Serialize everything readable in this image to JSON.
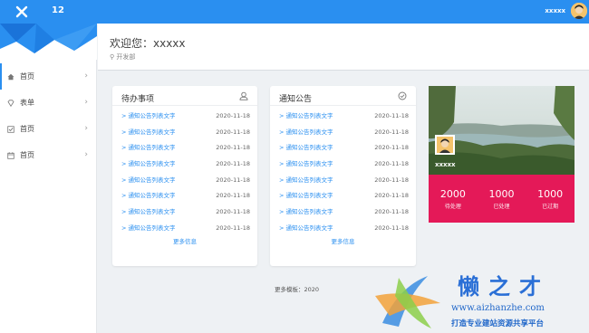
{
  "header": {
    "app_name": "12",
    "user_name": "xxxxx"
  },
  "welcome": {
    "greeting": "欢迎您：xxxxx",
    "department": "开发部"
  },
  "sidebar": {
    "items": [
      {
        "label": "首页",
        "icon": "home-icon"
      },
      {
        "label": "表单",
        "icon": "diamond-icon"
      },
      {
        "label": "首页",
        "icon": "checkbox-icon"
      },
      {
        "label": "首页",
        "icon": "calendar-icon"
      }
    ]
  },
  "todo": {
    "title": "待办事项",
    "more": "更多信息",
    "items": [
      {
        "text": "> 通知公告列表文字",
        "date": "2020-11-18"
      },
      {
        "text": "> 通知公告列表文字",
        "date": "2020-11-18"
      },
      {
        "text": "> 通知公告列表文字",
        "date": "2020-11-18"
      },
      {
        "text": "> 通知公告列表文字",
        "date": "2020-11-18"
      },
      {
        "text": "> 通知公告列表文字",
        "date": "2020-11-18"
      },
      {
        "text": "> 通知公告列表文字",
        "date": "2020-11-18"
      },
      {
        "text": "> 通知公告列表文字",
        "date": "2020-11-18"
      },
      {
        "text": "> 通知公告列表文字",
        "date": "2020-11-18"
      }
    ]
  },
  "notice": {
    "title": "通知公告",
    "more": "更多信息",
    "items": [
      {
        "text": "> 通知公告列表文字",
        "date": "2020-11-18"
      },
      {
        "text": "> 通知公告列表文字",
        "date": "2020-11-18"
      },
      {
        "text": "> 通知公告列表文字",
        "date": "2020-11-18"
      },
      {
        "text": "> 通知公告列表文字",
        "date": "2020-11-18"
      },
      {
        "text": "> 通知公告列表文字",
        "date": "2020-11-18"
      },
      {
        "text": "> 通知公告列表文字",
        "date": "2020-11-18"
      },
      {
        "text": "> 通知公告列表文字",
        "date": "2020-11-18"
      },
      {
        "text": "> 通知公告列表文字",
        "date": "2020-11-18"
      }
    ]
  },
  "profile": {
    "name": "xxxxx",
    "stats": [
      {
        "value": "2000",
        "label": "待处理"
      },
      {
        "value": "1000",
        "label": "已处理"
      },
      {
        "value": "1000",
        "label": "已过期"
      }
    ]
  },
  "footer": {
    "text": "更多模板：2020"
  },
  "watermark": {
    "brand": "懒之才",
    "url": "www.aizhanzhe.com",
    "slogan": "打造专业建站资源共享平台"
  },
  "colors": {
    "primary": "#2a8ff0",
    "accent": "#e41958",
    "background": "#eef1f4"
  }
}
